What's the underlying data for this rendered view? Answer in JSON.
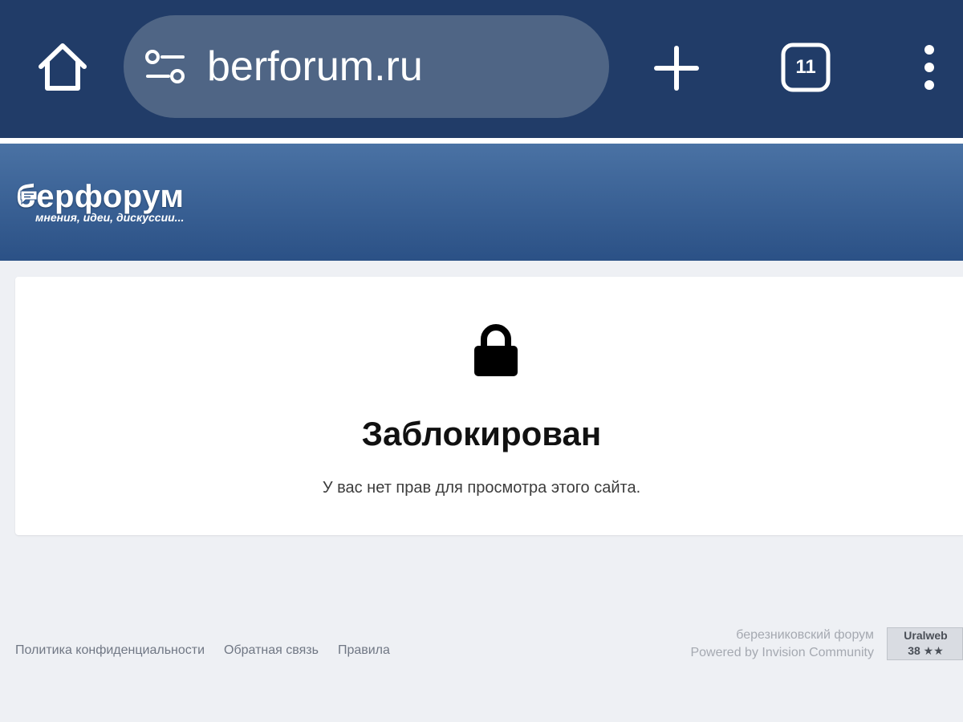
{
  "browser": {
    "url": "berforum.ru",
    "tabs_count": "11",
    "icons": [
      "home-icon",
      "site-settings-icon",
      "plus-icon",
      "tabs-icon",
      "more-vertical-icon"
    ],
    "bar_color": "#213c68"
  },
  "site": {
    "logo_name": "берфорум",
    "tagline": "мнения, идеи, дискуссии..."
  },
  "blocked": {
    "icon": "lock-icon",
    "title": "Заблокирован",
    "message": "У вас нет прав для просмотра этого сайта."
  },
  "footer": {
    "links": [
      "Политика конфиденциальности",
      "Обратная связь",
      "Правила"
    ],
    "credit_line1": "березниковский форум",
    "credit_line2": "Powered by Invision Community",
    "counter_name": "Uralweb",
    "counter_value": "38 ★★"
  }
}
